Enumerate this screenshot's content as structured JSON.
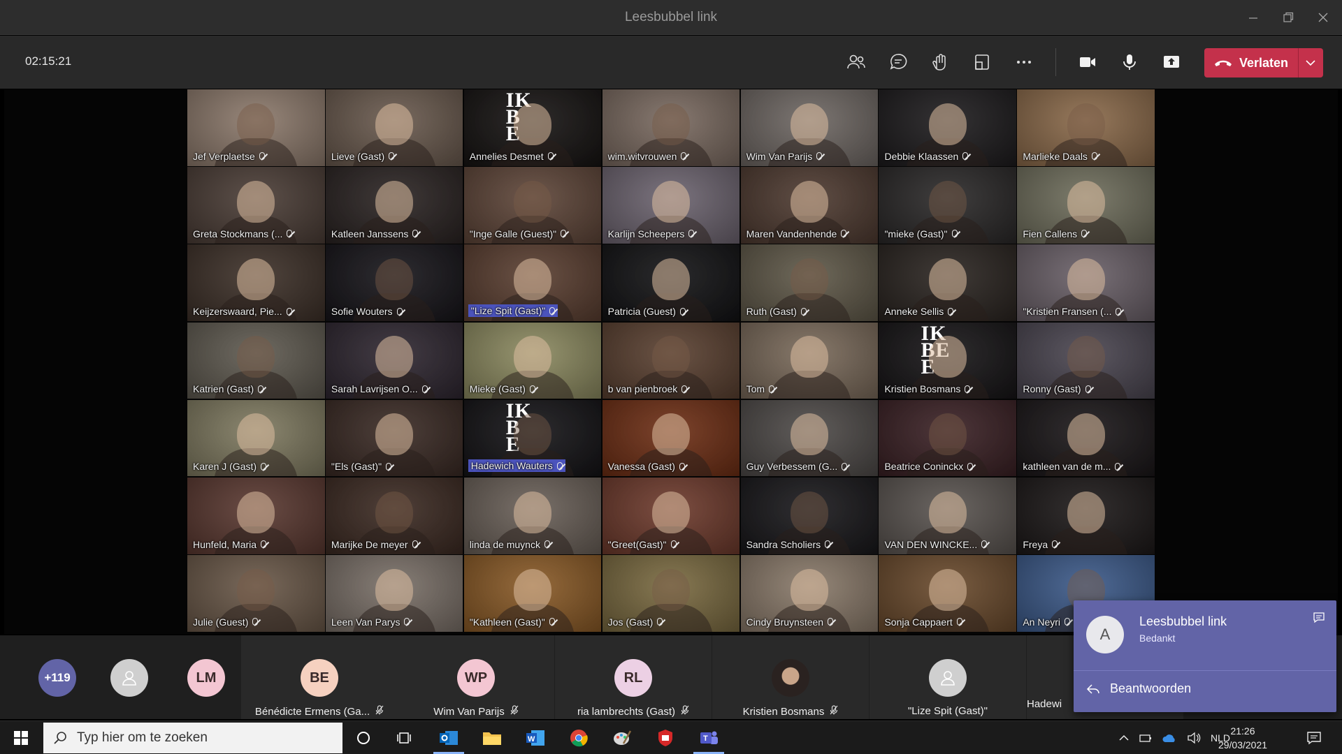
{
  "window": {
    "title": "Leesbubbel link"
  },
  "toolbar": {
    "timer": "02:15:21",
    "leave_label": "Verlaten"
  },
  "tiles": [
    {
      "name": "Jef Verplaetse",
      "bg": "#8d7a6c"
    },
    {
      "name": "Lieve (Gast)",
      "bg": "#6a5a4e"
    },
    {
      "name": "Annelies Desmet",
      "bg": "#161312",
      "logo": "IK\nB\nE"
    },
    {
      "name": "wim.witvrouwen",
      "bg": "#7a6a60"
    },
    {
      "name": "Wim Van Parijs",
      "bg": "#6e6763"
    },
    {
      "name": "Debbie Klaassen",
      "bg": "#1d1b1d"
    },
    {
      "name": "Marlieke Daals",
      "bg": "#8b6a4a"
    },
    {
      "name": "Greta Stockmans (...",
      "bg": "#4b3d36"
    },
    {
      "name": "Katleen Janssens",
      "bg": "#2a2322"
    },
    {
      "name": "\"Inge Galle (Guest)\"",
      "bg": "#5e4538"
    },
    {
      "name": "Karlijn Scheepers",
      "bg": "#6d6470"
    },
    {
      "name": "Maren Vandenhende",
      "bg": "#4e3a30"
    },
    {
      "name": "\"mieke (Gast)\"",
      "bg": "#2a2828"
    },
    {
      "name": "Fien Callens",
      "bg": "#6f6e5c"
    },
    {
      "name": "Keijzerswaard, Pie...",
      "bg": "#3d3028"
    },
    {
      "name": "Sofie Wouters",
      "bg": "#161419"
    },
    {
      "name": "\"Lize Spit (Gast)\"",
      "bg": "#5a3e30",
      "hl": true
    },
    {
      "name": "Patricia (Guest)",
      "bg": "#121214"
    },
    {
      "name": "Ruth (Gast)",
      "bg": "#5f5848"
    },
    {
      "name": "Anneke Sellis",
      "bg": "#2a2420"
    },
    {
      "name": "\"Kristien Fransen (...",
      "bg": "#6a6068"
    },
    {
      "name": "Katrien (Gast)",
      "bg": "#5f5a50"
    },
    {
      "name": "Sarah Lavrijsen O...",
      "bg": "#2e2630"
    },
    {
      "name": "Mieke (Gast)",
      "bg": "#8c8a60"
    },
    {
      "name": "b van pienbroek",
      "bg": "#5a4030"
    },
    {
      "name": "Tom",
      "bg": "#7a6a5a"
    },
    {
      "name": "Kristien Bosmans",
      "bg": "#161416",
      "logo": "IK\nBE\nE"
    },
    {
      "name": "Ronny (Gast)",
      "bg": "#4a4550"
    },
    {
      "name": "Karen J (Gast)",
      "bg": "#7f7a60"
    },
    {
      "name": "\"Els (Gast)\"",
      "bg": "#3a2a24"
    },
    {
      "name": "Hadewich Wauters",
      "bg": "#141316",
      "logo": "IK\nB\nE",
      "hl": true
    },
    {
      "name": "Vanessa (Gast)",
      "bg": "#6e2e14"
    },
    {
      "name": "Guy Verbessem (G...",
      "bg": "#4e4a48"
    },
    {
      "name": "Beatrice Coninckx",
      "bg": "#3a2024"
    },
    {
      "name": "kathleen van de m...",
      "bg": "#1a1618"
    },
    {
      "name": "Hunfeld, Maria",
      "bg": "#5a3830"
    },
    {
      "name": "Marijke De meyer",
      "bg": "#3c2a22"
    },
    {
      "name": "linda de muynck",
      "bg": "#6a6058"
    },
    {
      "name": "\"Greet(Gast)\"",
      "bg": "#6e3a2c"
    },
    {
      "name": "Sandra Scholiers",
      "bg": "#18171a"
    },
    {
      "name": "VAN DEN WINCKE...",
      "bg": "#5a5450"
    },
    {
      "name": "Freya",
      "bg": "#1c1818"
    },
    {
      "name": "Julie (Guest)",
      "bg": "#6a5848"
    },
    {
      "name": "Leen Van Parys",
      "bg": "#7a7068"
    },
    {
      "name": "\"Kathleen (Gast)\"",
      "bg": "#8a5a26"
    },
    {
      "name": "Jos (Gast)",
      "bg": "#7a6a40"
    },
    {
      "name": "Cindy Bruynsteen",
      "bg": "#8a7a6a"
    },
    {
      "name": "Sonja Cappaert",
      "bg": "#6a4a2c"
    },
    {
      "name": "An Neyri",
      "bg": "#3c5a8a"
    }
  ],
  "roster": {
    "overflow_count": "+119",
    "people": [
      {
        "initials": "",
        "name": "",
        "color": "#cfcfcf",
        "type": "anon"
      },
      {
        "initials": "LM",
        "name": "",
        "color": "#f3c6d2"
      },
      {
        "initials": "BE",
        "name": "Bénédicte Ermens (Ga...",
        "color": "#f6d1c0"
      },
      {
        "initials": "WP",
        "name": "Wim Van Parijs",
        "color": "#f3c6d2"
      },
      {
        "initials": "RL",
        "name": "ria lambrechts (Gast)",
        "color": "#ecd0e4"
      },
      {
        "initials": "",
        "name": "Kristien Bosmans",
        "color": "#3a3330",
        "type": "photo"
      },
      {
        "initials": "",
        "name": "\"Lize Spit (Gast)\"",
        "color": "#cfcfcf",
        "type": "anon"
      },
      {
        "initials": "",
        "name": "Hadewi",
        "color": "#1f1f1f",
        "type": "none"
      }
    ]
  },
  "notification": {
    "avatar": "A",
    "title": "Leesbubbel link",
    "body": "Bedankt",
    "reply_label": "Beantwoorden"
  },
  "taskbar": {
    "search_placeholder": "Typ hier om te zoeken",
    "lang": "NLD",
    "time": "21:26",
    "date": "29/03/2021"
  }
}
